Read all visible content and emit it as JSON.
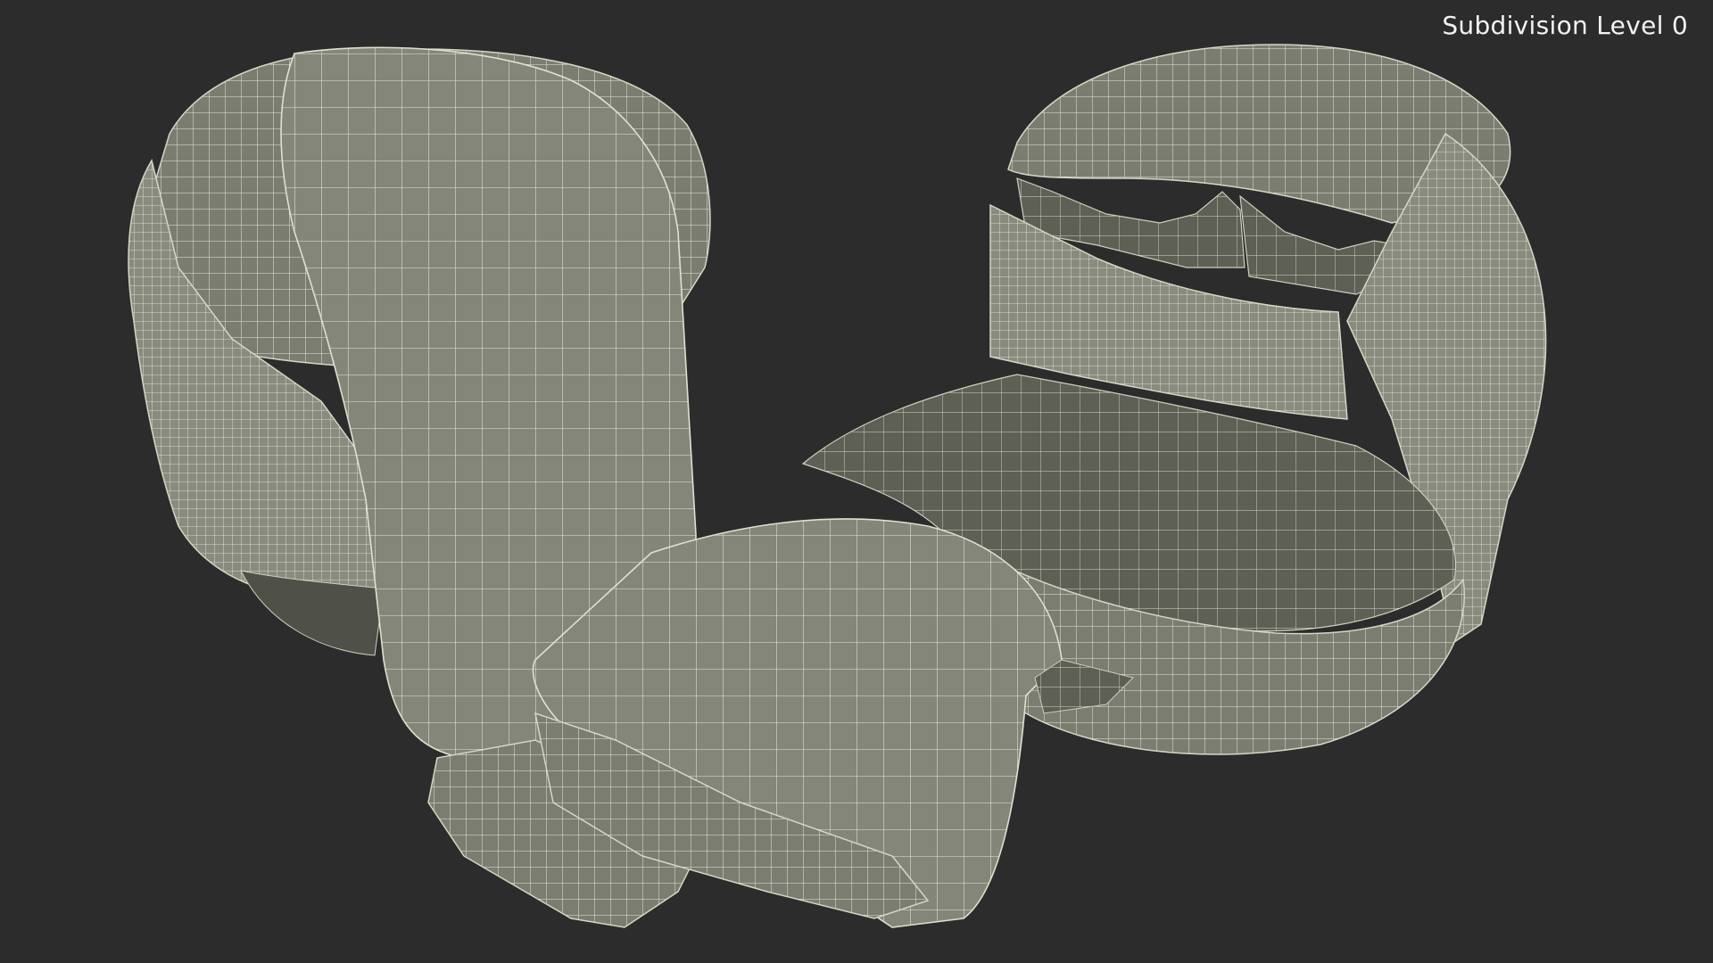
{
  "viewport": {
    "subdivision_label": "Subdivision Level 0"
  },
  "colors": {
    "background": "#2c2c2c",
    "surface": "#858679",
    "surface_dark": "#5f6056",
    "wireframe": "#e8e8d8"
  }
}
